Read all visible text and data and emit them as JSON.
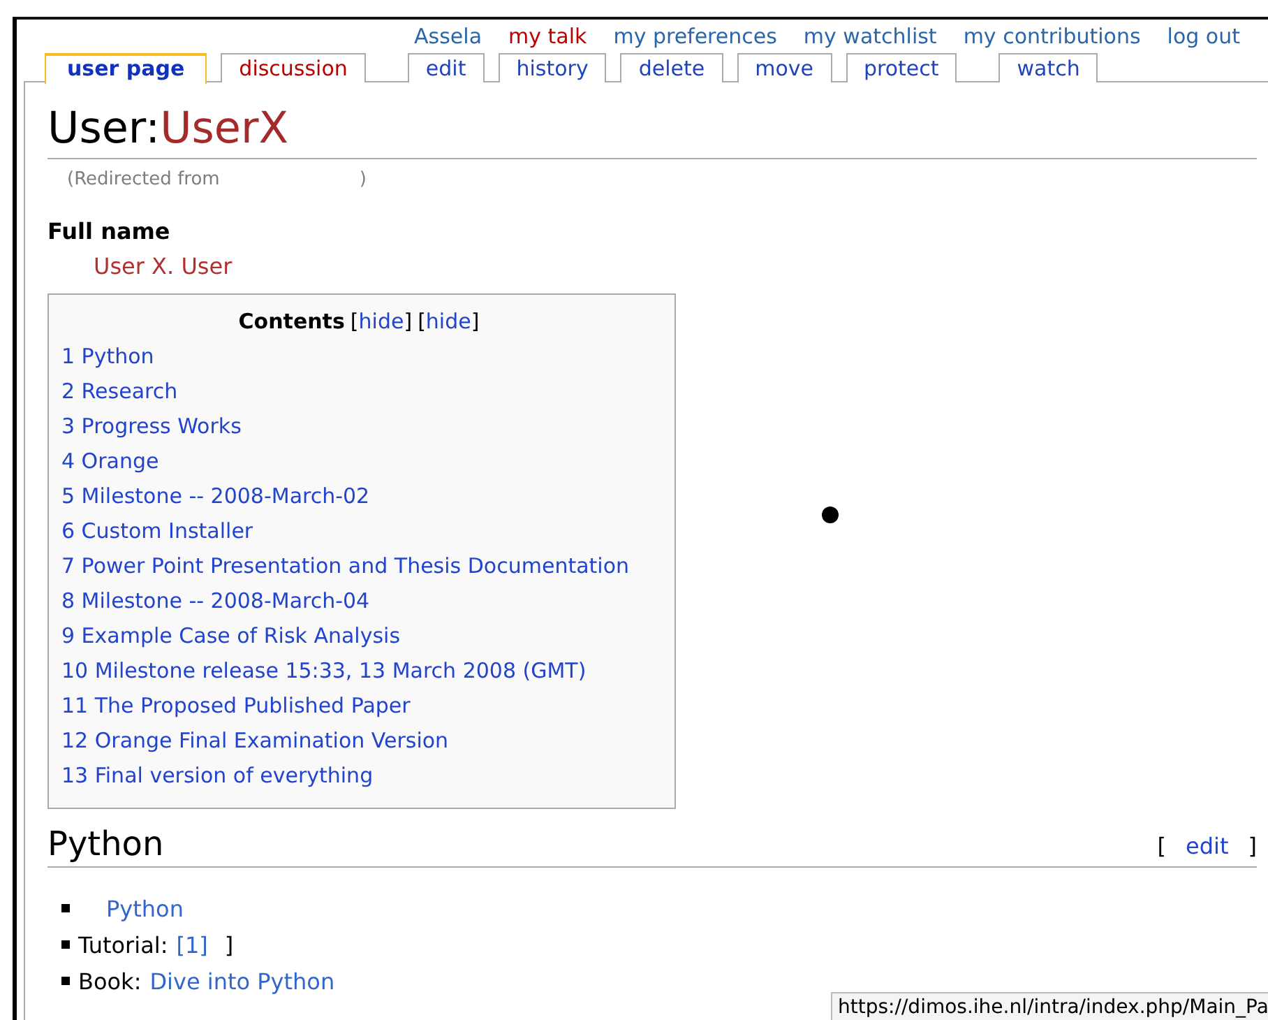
{
  "personal_links": [
    {
      "label": "Assela",
      "exists": true
    },
    {
      "label": "my talk",
      "exists": false
    },
    {
      "label": "my preferences",
      "exists": true
    },
    {
      "label": "my watchlist",
      "exists": true
    },
    {
      "label": "my contributions",
      "exists": true
    },
    {
      "label": "log out",
      "exists": true
    }
  ],
  "tab_groups": [
    [
      {
        "label": "user page",
        "selected": true,
        "exists": true
      },
      {
        "label": "discussion",
        "selected": false,
        "exists": false
      }
    ],
    [
      {
        "label": "edit",
        "selected": false,
        "exists": true
      },
      {
        "label": "history",
        "selected": false,
        "exists": true
      },
      {
        "label": "delete",
        "selected": false,
        "exists": true
      },
      {
        "label": "move",
        "selected": false,
        "exists": true
      },
      {
        "label": "protect",
        "selected": false,
        "exists": true
      }
    ],
    [
      {
        "label": "watch",
        "selected": false,
        "exists": true
      }
    ]
  ],
  "title": {
    "namespace": "User:",
    "name": "UserX",
    "exists": false
  },
  "redirect": {
    "before": "(Redirected from",
    "after": ")"
  },
  "full_name": {
    "heading": "Full name",
    "value": "User X. User"
  },
  "toc": {
    "title": "Contents",
    "links": [
      {
        "open": "[",
        "label": "hide",
        "close": "]"
      },
      {
        "open": "[",
        "label": "hide",
        "close": "]"
      }
    ],
    "items": [
      {
        "number": "1",
        "text": "Python"
      },
      {
        "number": "2",
        "text": "Research"
      },
      {
        "number": "3",
        "text": "Progress Works"
      },
      {
        "number": "4",
        "text": "Orange"
      },
      {
        "number": "5",
        "text": "Milestone -- 2008-March-02"
      },
      {
        "number": "6",
        "text": "Custom Installer"
      },
      {
        "number": "7",
        "text": "Power Point Presentation and Thesis Documentation"
      },
      {
        "number": "8",
        "text": "Milestone -- 2008-March-04"
      },
      {
        "number": "9",
        "text": "Example Case of Risk Analysis"
      },
      {
        "number": "10",
        "text": "Milestone release 15:33, 13 March 2008 (GMT)"
      },
      {
        "number": "11",
        "text": "The Proposed Published Paper"
      },
      {
        "number": "12",
        "text": "Orange Final Examination Version"
      },
      {
        "number": "13",
        "text": "Final version of everything"
      }
    ]
  },
  "section": {
    "heading": "Python",
    "edit": {
      "open": "[",
      "label": "edit",
      "close": "]"
    },
    "items": [
      {
        "link": "Python"
      },
      {
        "text": "Tutorial:",
        "link": "[1]",
        "after": "]"
      },
      {
        "text": "Book:",
        "link": "Dive into Python"
      }
    ]
  },
  "status_bar": {
    "url": "https://dimos.ihe.nl/intra/index.php/Main_Pa"
  }
}
